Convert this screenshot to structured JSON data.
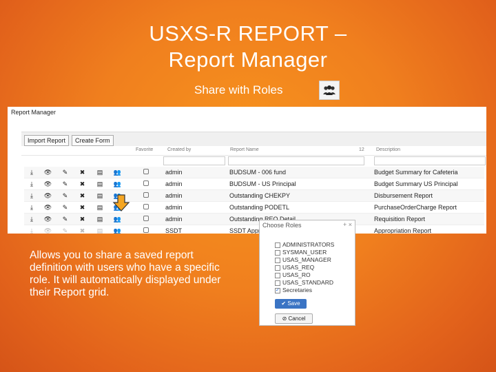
{
  "slide": {
    "title_line1": "USXS-R REPORT –",
    "title_line2": "Report Manager",
    "subtitle": "Share with Roles",
    "body": "Allows you to share a saved report definition with users who have a specific role.  It will automatically displayed under their Report grid."
  },
  "report_manager": {
    "title": "Report Manager",
    "buttons": {
      "import": "Import Report",
      "create": "Create Form"
    },
    "headers": {
      "favorite": "Favorite",
      "created_by": "Created by",
      "report_name": "Report Name",
      "description": "Description",
      "size": "12"
    },
    "rows": [
      {
        "created_by": "admin",
        "report_name": "BUDSUM - 006 fund",
        "description": "Budget Summary for Cafeteria"
      },
      {
        "created_by": "admin",
        "report_name": "BUDSUM - US Principal",
        "description": "Budget Summary US Principal"
      },
      {
        "created_by": "admin",
        "report_name": "Outstanding CHEKPY",
        "description": "Disbursement Report"
      },
      {
        "created_by": "admin",
        "report_name": "Outstanding PODETL",
        "description": "PurchaseOrderCharge Report"
      },
      {
        "created_by": "admin",
        "report_name": "Outstanding REQ Detail",
        "description": "Requisition Report"
      },
      {
        "created_by": "SSDT",
        "report_name": "SSDT Appr",
        "description": "Appropriation Report"
      }
    ]
  },
  "roles_dialog": {
    "title": "Choose Roles",
    "controls": "+ ×",
    "roles": [
      {
        "label": "ADMINISTRATORS",
        "checked": false
      },
      {
        "label": "SYSMAN_USER",
        "checked": false
      },
      {
        "label": "USAS_MANAGER",
        "checked": false
      },
      {
        "label": "USAS_REQ",
        "checked": false
      },
      {
        "label": "USAS_RO",
        "checked": false
      },
      {
        "label": "USAS_STANDARD",
        "checked": false
      },
      {
        "label": "Secretaries",
        "checked": true
      }
    ],
    "save_label": "Save",
    "cancel_label": "Cancel"
  },
  "colors": {
    "background": "#f07f1e",
    "save": "#3a74c4",
    "arrow": "#f5a623"
  }
}
